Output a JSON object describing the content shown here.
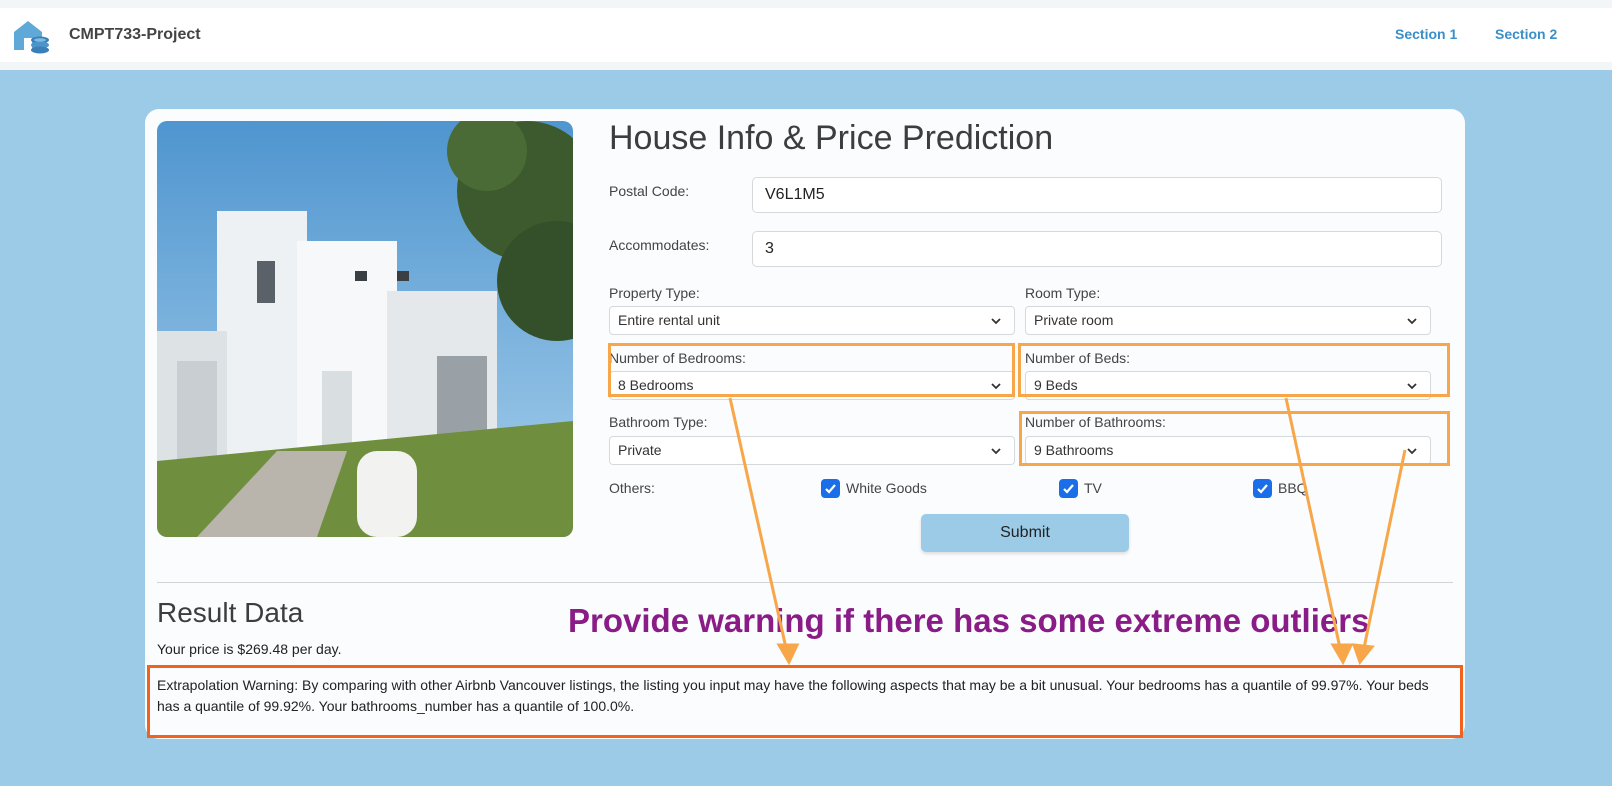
{
  "navbar": {
    "brand": "CMPT733-Project",
    "links": [
      "Section 1",
      "Section 2"
    ]
  },
  "form": {
    "title": "House Info & Price Prediction",
    "postal_code": {
      "label": "Postal Code:",
      "value": "V6L1M5"
    },
    "accommodates": {
      "label": "Accommodates:",
      "value": "3"
    },
    "property_type": {
      "label": "Property Type:",
      "value": "Entire rental unit"
    },
    "room_type": {
      "label": "Room Type:",
      "value": "Private room"
    },
    "bedrooms": {
      "label": "Number of Bedrooms:",
      "value": "8 Bedrooms"
    },
    "beds": {
      "label": "Number of Beds:",
      "value": "9 Beds"
    },
    "bathroom_type": {
      "label": "Bathroom Type:",
      "value": "Private"
    },
    "bathrooms": {
      "label": "Number of Bathrooms:",
      "value": "9 Bathrooms"
    },
    "others": {
      "label": "Others:",
      "options": [
        {
          "label": "White Goods",
          "checked": true
        },
        {
          "label": "TV",
          "checked": true
        },
        {
          "label": "BBQ",
          "checked": true
        }
      ]
    },
    "submit_label": "Submit"
  },
  "result": {
    "title": "Result Data",
    "price_text": "Your price is $269.48 per day.",
    "warning_text": "Extrapolation Warning: By comparing with other Airbnb Vancouver listings, the listing you input may have the following aspects that may be a bit unusual. Your bedrooms has a quantile of 99.97%. Your beds has a quantile of 99.92%. Your bathrooms_number has a quantile of 100.0%."
  },
  "annotation": {
    "text": "Provide warning if there has some extreme outliers",
    "highlight_color": "#f7a74a",
    "warning_box_color": "#f2621f",
    "text_color": "#8a1c88"
  },
  "colors": {
    "background": "#9ccbe8",
    "nav_link": "#3a8fc9",
    "checkbox": "#1a6fe8"
  }
}
